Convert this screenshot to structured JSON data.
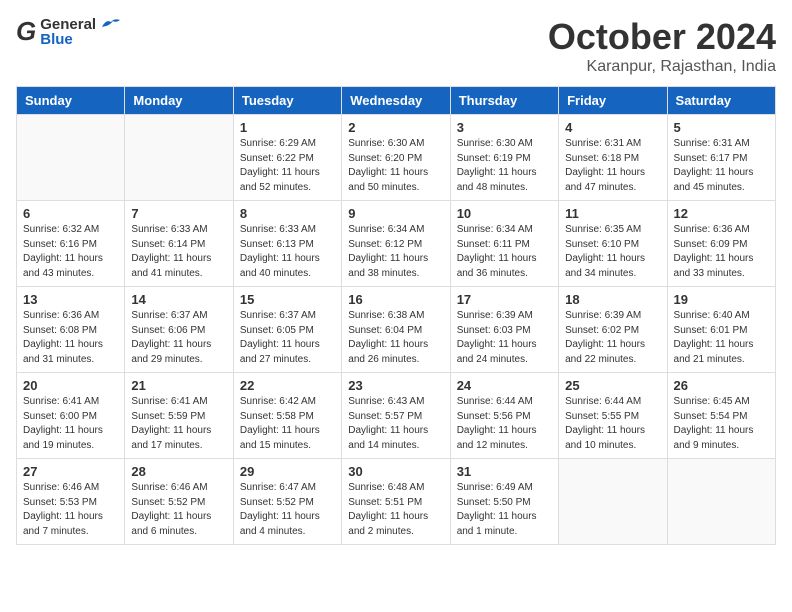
{
  "header": {
    "logo_top": "General",
    "logo_bot": "Blue",
    "month": "October 2024",
    "location": "Karanpur, Rajasthan, India"
  },
  "days_of_week": [
    "Sunday",
    "Monday",
    "Tuesday",
    "Wednesday",
    "Thursday",
    "Friday",
    "Saturday"
  ],
  "weeks": [
    [
      {
        "day": "",
        "info": ""
      },
      {
        "day": "",
        "info": ""
      },
      {
        "day": "1",
        "info": "Sunrise: 6:29 AM\nSunset: 6:22 PM\nDaylight: 11 hours and 52 minutes."
      },
      {
        "day": "2",
        "info": "Sunrise: 6:30 AM\nSunset: 6:20 PM\nDaylight: 11 hours and 50 minutes."
      },
      {
        "day": "3",
        "info": "Sunrise: 6:30 AM\nSunset: 6:19 PM\nDaylight: 11 hours and 48 minutes."
      },
      {
        "day": "4",
        "info": "Sunrise: 6:31 AM\nSunset: 6:18 PM\nDaylight: 11 hours and 47 minutes."
      },
      {
        "day": "5",
        "info": "Sunrise: 6:31 AM\nSunset: 6:17 PM\nDaylight: 11 hours and 45 minutes."
      }
    ],
    [
      {
        "day": "6",
        "info": "Sunrise: 6:32 AM\nSunset: 6:16 PM\nDaylight: 11 hours and 43 minutes."
      },
      {
        "day": "7",
        "info": "Sunrise: 6:33 AM\nSunset: 6:14 PM\nDaylight: 11 hours and 41 minutes."
      },
      {
        "day": "8",
        "info": "Sunrise: 6:33 AM\nSunset: 6:13 PM\nDaylight: 11 hours and 40 minutes."
      },
      {
        "day": "9",
        "info": "Sunrise: 6:34 AM\nSunset: 6:12 PM\nDaylight: 11 hours and 38 minutes."
      },
      {
        "day": "10",
        "info": "Sunrise: 6:34 AM\nSunset: 6:11 PM\nDaylight: 11 hours and 36 minutes."
      },
      {
        "day": "11",
        "info": "Sunrise: 6:35 AM\nSunset: 6:10 PM\nDaylight: 11 hours and 34 minutes."
      },
      {
        "day": "12",
        "info": "Sunrise: 6:36 AM\nSunset: 6:09 PM\nDaylight: 11 hours and 33 minutes."
      }
    ],
    [
      {
        "day": "13",
        "info": "Sunrise: 6:36 AM\nSunset: 6:08 PM\nDaylight: 11 hours and 31 minutes."
      },
      {
        "day": "14",
        "info": "Sunrise: 6:37 AM\nSunset: 6:06 PM\nDaylight: 11 hours and 29 minutes."
      },
      {
        "day": "15",
        "info": "Sunrise: 6:37 AM\nSunset: 6:05 PM\nDaylight: 11 hours and 27 minutes."
      },
      {
        "day": "16",
        "info": "Sunrise: 6:38 AM\nSunset: 6:04 PM\nDaylight: 11 hours and 26 minutes."
      },
      {
        "day": "17",
        "info": "Sunrise: 6:39 AM\nSunset: 6:03 PM\nDaylight: 11 hours and 24 minutes."
      },
      {
        "day": "18",
        "info": "Sunrise: 6:39 AM\nSunset: 6:02 PM\nDaylight: 11 hours and 22 minutes."
      },
      {
        "day": "19",
        "info": "Sunrise: 6:40 AM\nSunset: 6:01 PM\nDaylight: 11 hours and 21 minutes."
      }
    ],
    [
      {
        "day": "20",
        "info": "Sunrise: 6:41 AM\nSunset: 6:00 PM\nDaylight: 11 hours and 19 minutes."
      },
      {
        "day": "21",
        "info": "Sunrise: 6:41 AM\nSunset: 5:59 PM\nDaylight: 11 hours and 17 minutes."
      },
      {
        "day": "22",
        "info": "Sunrise: 6:42 AM\nSunset: 5:58 PM\nDaylight: 11 hours and 15 minutes."
      },
      {
        "day": "23",
        "info": "Sunrise: 6:43 AM\nSunset: 5:57 PM\nDaylight: 11 hours and 14 minutes."
      },
      {
        "day": "24",
        "info": "Sunrise: 6:44 AM\nSunset: 5:56 PM\nDaylight: 11 hours and 12 minutes."
      },
      {
        "day": "25",
        "info": "Sunrise: 6:44 AM\nSunset: 5:55 PM\nDaylight: 11 hours and 10 minutes."
      },
      {
        "day": "26",
        "info": "Sunrise: 6:45 AM\nSunset: 5:54 PM\nDaylight: 11 hours and 9 minutes."
      }
    ],
    [
      {
        "day": "27",
        "info": "Sunrise: 6:46 AM\nSunset: 5:53 PM\nDaylight: 11 hours and 7 minutes."
      },
      {
        "day": "28",
        "info": "Sunrise: 6:46 AM\nSunset: 5:52 PM\nDaylight: 11 hours and 6 minutes."
      },
      {
        "day": "29",
        "info": "Sunrise: 6:47 AM\nSunset: 5:52 PM\nDaylight: 11 hours and 4 minutes."
      },
      {
        "day": "30",
        "info": "Sunrise: 6:48 AM\nSunset: 5:51 PM\nDaylight: 11 hours and 2 minutes."
      },
      {
        "day": "31",
        "info": "Sunrise: 6:49 AM\nSunset: 5:50 PM\nDaylight: 11 hours and 1 minute."
      },
      {
        "day": "",
        "info": ""
      },
      {
        "day": "",
        "info": ""
      }
    ]
  ]
}
